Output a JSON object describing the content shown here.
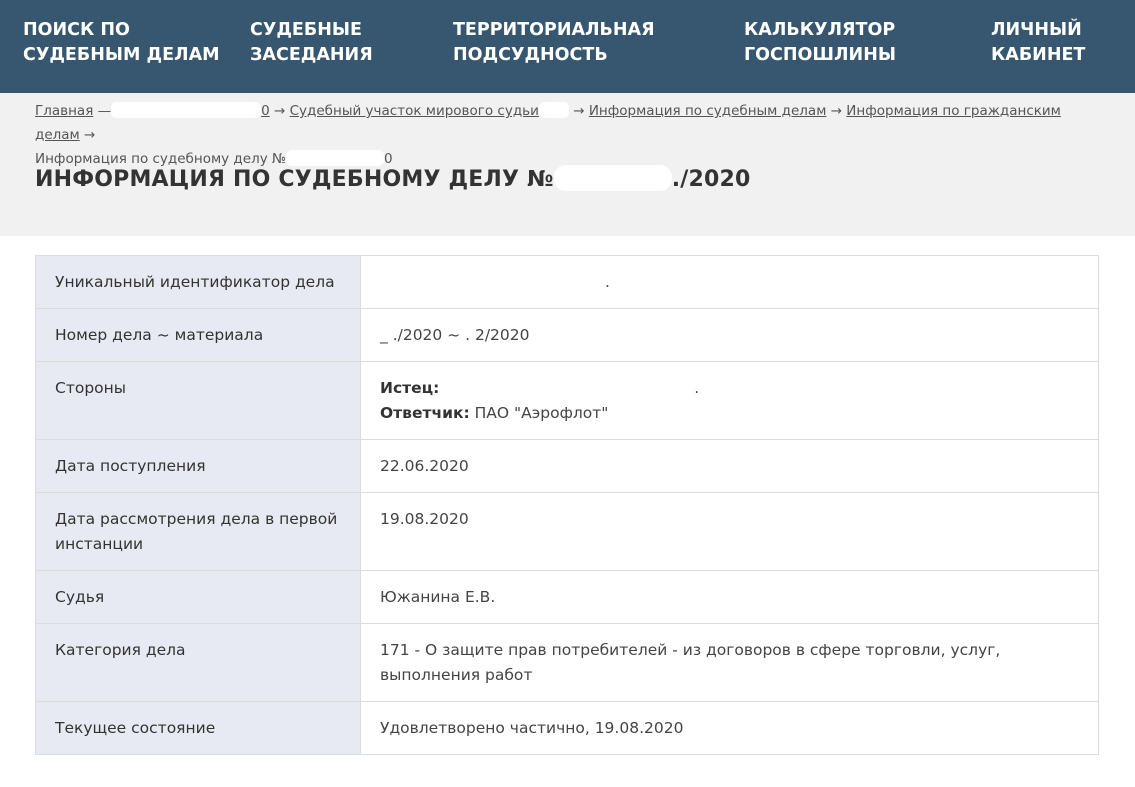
{
  "nav": {
    "items": [
      {
        "line1": "Поиск по",
        "line2": "судебным делам"
      },
      {
        "line1": "Судебные",
        "line2": "заседания"
      },
      {
        "line1": "Территориальная",
        "line2": "подсудность"
      },
      {
        "line1": "Калькулятор",
        "line2": "госпошлины"
      },
      {
        "line1": "Личный",
        "line2": "кабинет"
      }
    ]
  },
  "breadcrumb": {
    "home": "Главная",
    "home_tail": " —",
    "partial1": "0",
    "court": "Судебный участок мирового судьи",
    "cases_info": "Информация по судебным делам",
    "civil_info": "Информация по гражданским делам",
    "current_prefix": "Информация по судебному делу №",
    "current_suffix": "0",
    "arrow": "→"
  },
  "page": {
    "title_prefix": "ИНФОРМАЦИЯ ПО СУДЕБНОМУ ДЕЛУ №",
    "title_suffix": "./2020"
  },
  "table": {
    "rows": [
      {
        "label": "Уникальный идентификатор дела",
        "value": "."
      },
      {
        "label": "Номер дела ~ материала",
        "value": "_ ./2020 ~ . 2/2020"
      },
      {
        "label": "Стороны",
        "plaintiff_label": "Истец:",
        "plaintiff_value": ".",
        "defendant_label": "Ответчик:",
        "defendant_value": "ПАО \"Аэрофлот\""
      },
      {
        "label": "Дата поступления",
        "value": "22.06.2020"
      },
      {
        "label": "Дата рассмотрения дела в первой инстанции",
        "value": "19.08.2020"
      },
      {
        "label": "Судья",
        "value": "Южанина Е.В."
      },
      {
        "label": "Категория дела",
        "value": "171 - О защите прав потребителей - из договоров в сфере торговли, услуг, выполнения работ"
      },
      {
        "label": "Текущее состояние",
        "value": "Удовлетворено частично, 19.08.2020"
      }
    ]
  }
}
